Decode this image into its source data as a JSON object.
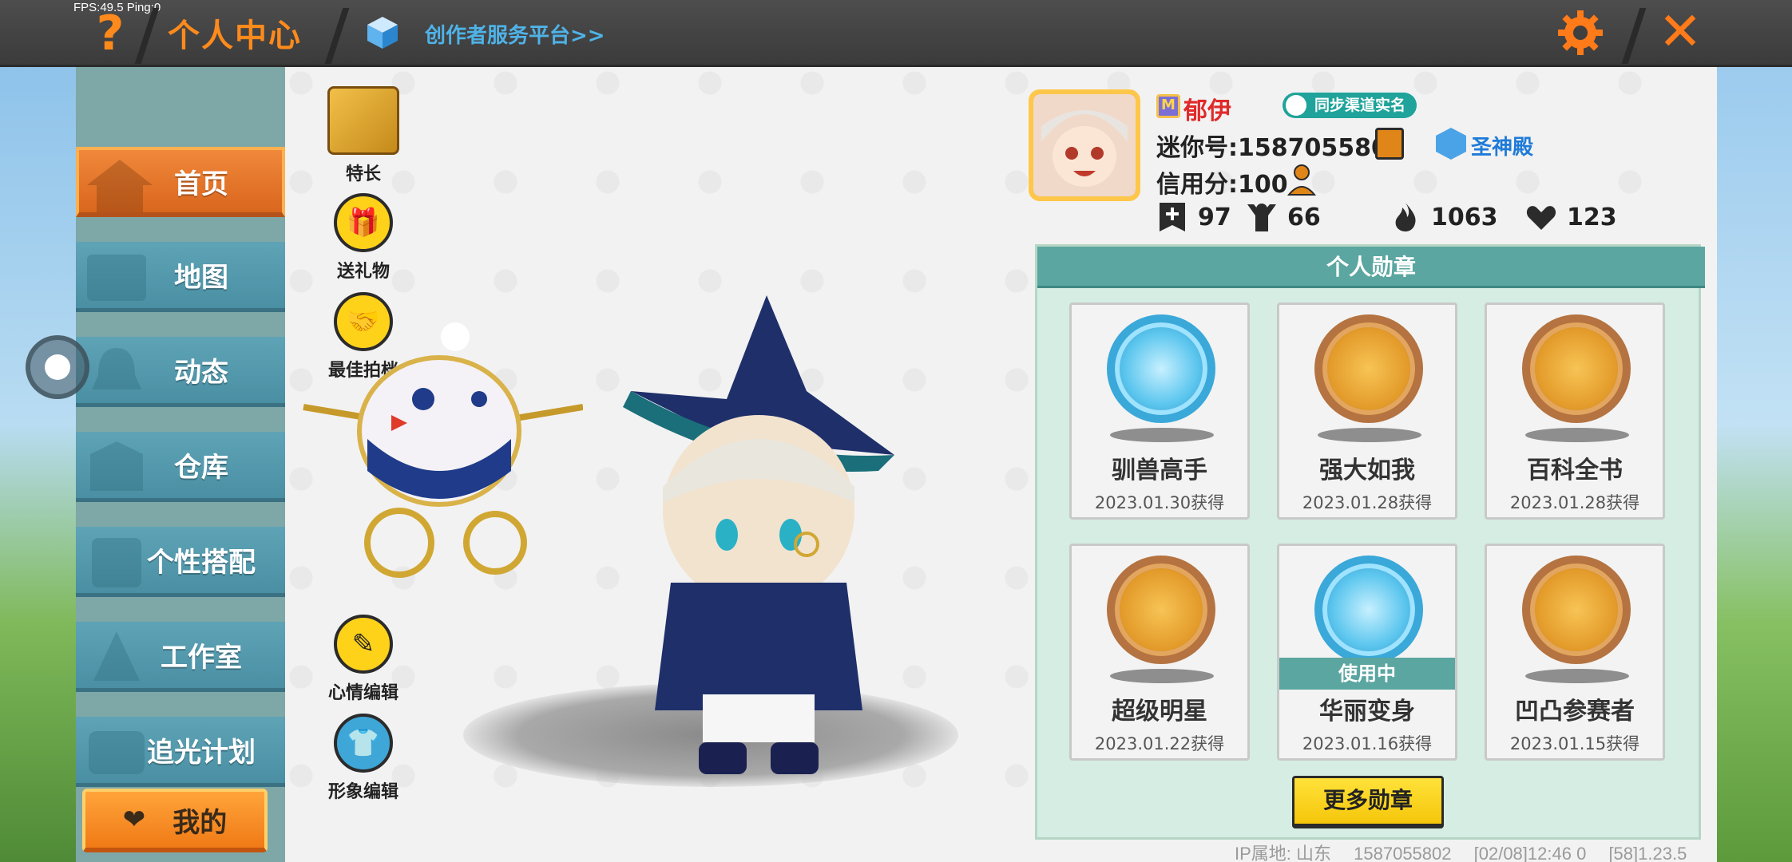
{
  "topbar": {
    "fps_text": "FPS:49.5  Ping:0",
    "help_symbol": "?",
    "title": "个人中心",
    "creator_link": "创作者服务平台>>",
    "close_symbol": "✕"
  },
  "sidebar": {
    "items": [
      {
        "label": "首页",
        "icon": "home-icon",
        "active": true
      },
      {
        "label": "地图",
        "icon": "map-icon"
      },
      {
        "label": "动态",
        "icon": "bell-icon"
      },
      {
        "label": "仓库",
        "icon": "warehouse-icon"
      },
      {
        "label": "个性搭配",
        "icon": "outfit-icon"
      },
      {
        "label": "工作室",
        "icon": "studio-icon"
      },
      {
        "label": "追光计划",
        "icon": "chase-light-icon"
      }
    ],
    "mine_label": "我的"
  },
  "actions": {
    "specialty": "特长",
    "gift": "送礼物",
    "partner": "最佳拍档",
    "mood": "心情编辑",
    "appearance": "形象编辑"
  },
  "profile": {
    "nickname": "郁伊",
    "sync_badge": "同步渠道实名",
    "mini_id": "迷你号:1587055802",
    "temple": "圣神殿",
    "credit": "信用分:100",
    "stats": {
      "followers": "97",
      "following": "66",
      "popularity": "1063",
      "likes": "123"
    }
  },
  "medals": {
    "title": "个人勋章",
    "in_use_label": "使用中",
    "more_button": "更多勋章",
    "items": [
      {
        "name": "驯兽高手",
        "date": "2023.01.30获得"
      },
      {
        "name": "强大如我",
        "date": "2023.01.28获得"
      },
      {
        "name": "百科全书",
        "date": "2023.01.28获得"
      },
      {
        "name": "超级明星",
        "date": "2023.01.22获得"
      },
      {
        "name": "华丽变身",
        "date": "2023.01.16获得"
      },
      {
        "name": "凹凸参赛者",
        "date": "2023.01.15获得"
      }
    ]
  },
  "footer": {
    "ip": "IP属地: 山东",
    "uid": "1587055802",
    "time": "[02/08]12:46 0",
    "version": "[58]1.23.5"
  },
  "colors": {
    "accent_orange": "#ff8a1c",
    "nav_blue": "#4a8fa3",
    "medal_teal": "#5ba6a0",
    "button_yellow": "#f5c60a"
  }
}
